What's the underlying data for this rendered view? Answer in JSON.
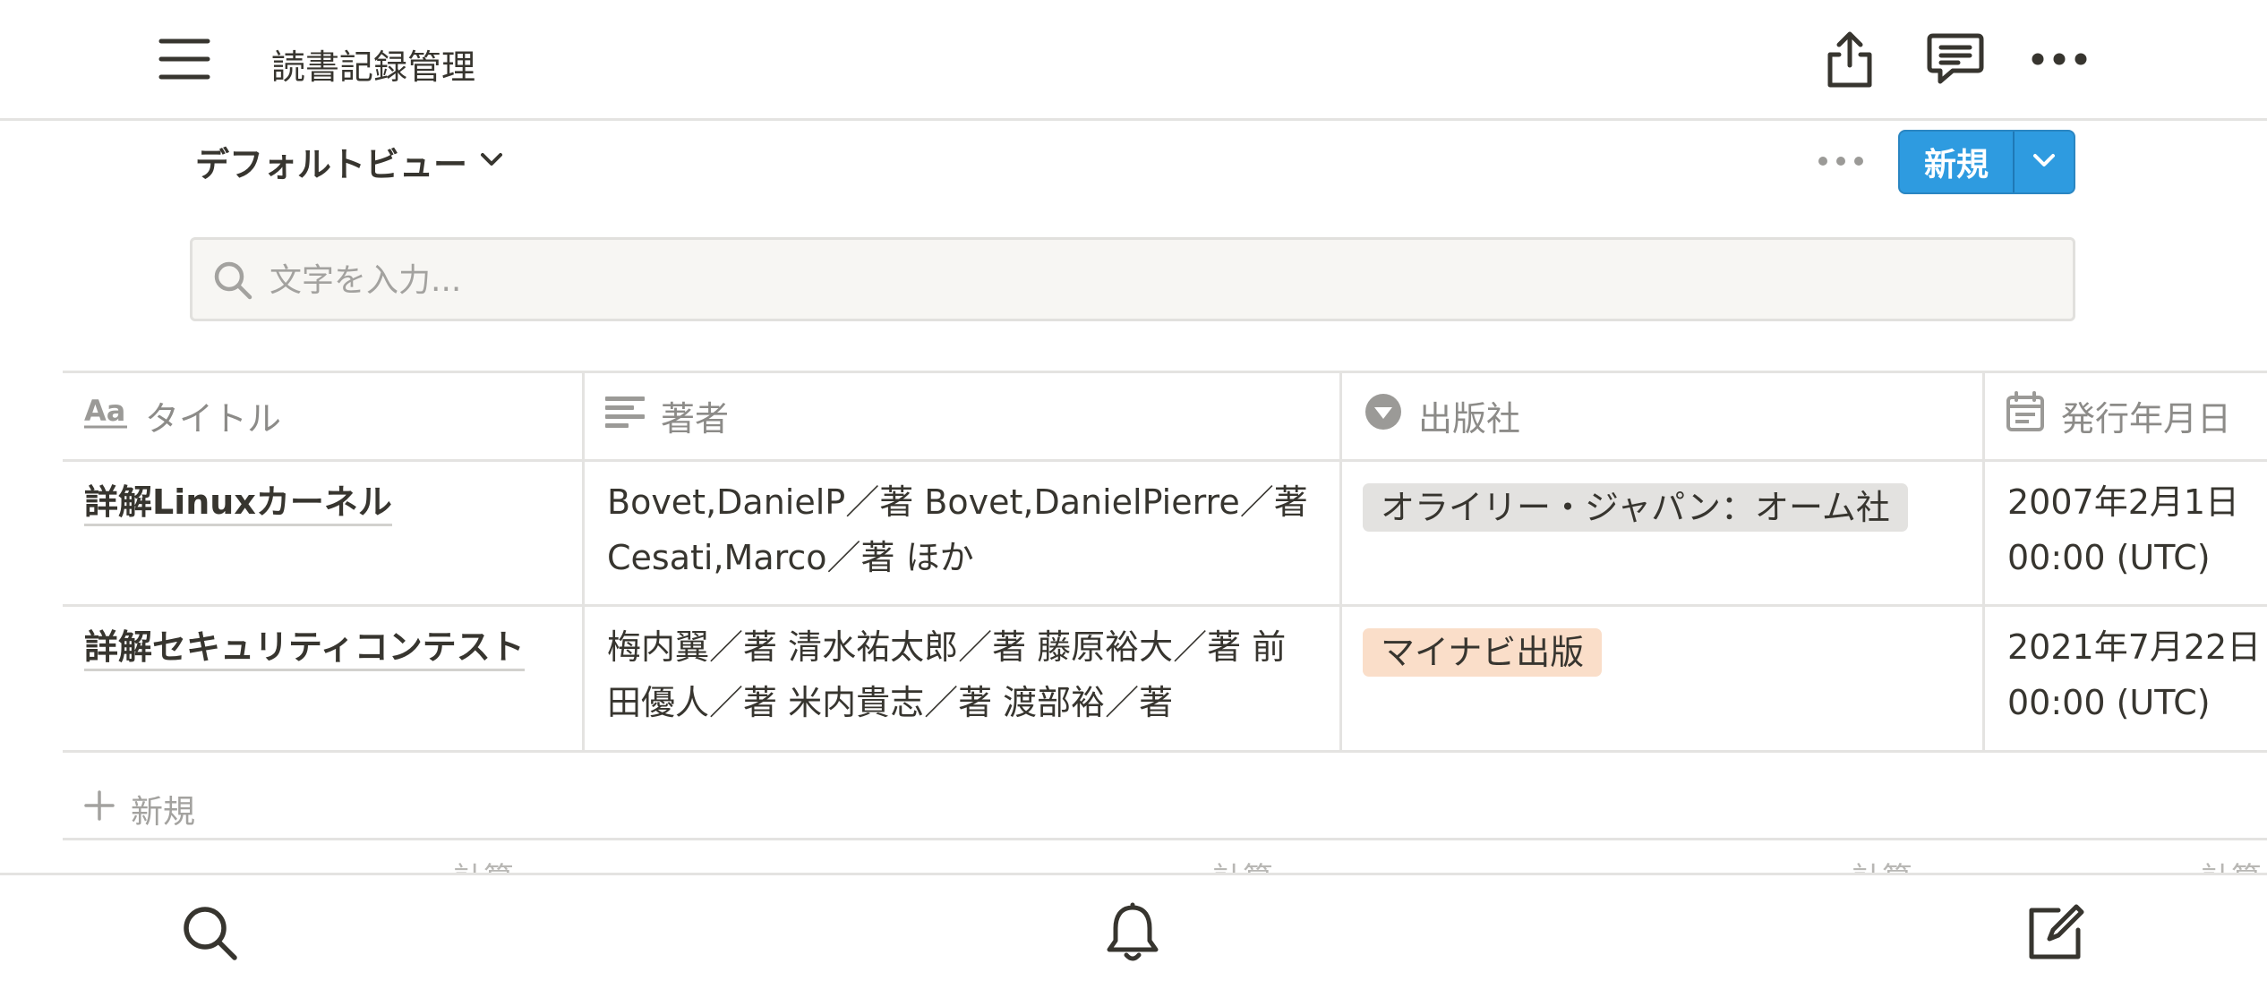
{
  "app": {
    "page_title": "読書記録管理"
  },
  "view": {
    "name": "デフォルトビュー",
    "new_button": "新規"
  },
  "search": {
    "placeholder": "文字を入力..."
  },
  "table": {
    "columns": [
      "タイトル",
      "著者",
      "出版社",
      "発行年月日"
    ],
    "column_icons": [
      "text-aa-icon",
      "lines-icon",
      "select-arrow-icon",
      "calendar-icon"
    ],
    "rows": [
      {
        "title": "詳解Linuxカーネル",
        "author_line1": "Bovet,DanielP／著 Bovet,DanielPierre／著",
        "author_line2": "Cesati,Marco／著 ほか",
        "publisher": "オライリー・ジャパン：オーム社",
        "publisher_color": "#e3e2e0",
        "date_line1": "2007年2月1日",
        "date_line2": "00:00 (UTC)"
      },
      {
        "title": "詳解セキュリティコンテスト",
        "author_line1": "梅内翼／著 清水祐太郎／著 藤原裕大／著 前",
        "author_line2": "田優人／著 米内貴志／著 渡部裕／著",
        "publisher": "マイナビ出版",
        "publisher_color": "#fadec9",
        "date_line1": "2021年7月22日",
        "date_line2": "00:00 (UTC)"
      }
    ],
    "new_row": "新規",
    "calc_label": "計算"
  },
  "colors": {
    "accent": "#2e9be0",
    "border": "#e4e3e1",
    "text": "#37352f",
    "muted": "#8c8b88"
  }
}
